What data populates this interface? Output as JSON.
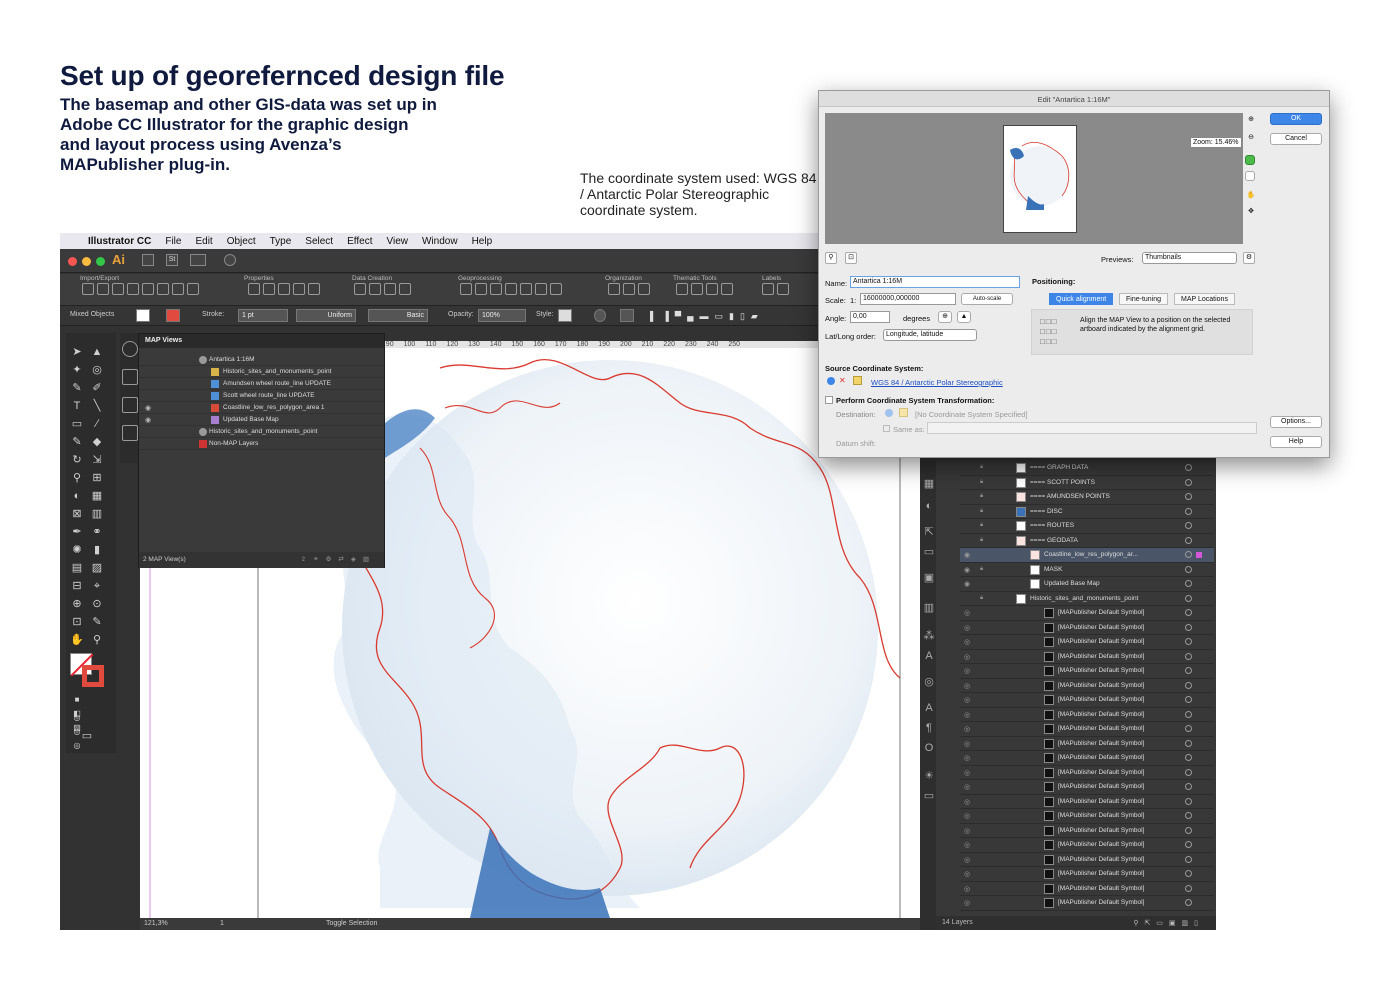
{
  "header": {
    "title": "Set up of georefernced design file",
    "subtitle": "The basemap and other GIS-data was set up in Adobe CC Illustrator for the graphic design and layout process using Avenza’s MAPublisher plug-in.",
    "coord_note": "The coordinate system used: WGS 84 / Antarctic Polar Stereographic coordinate system."
  },
  "menubar": {
    "app_name": "Illustrator CC",
    "items": [
      "File",
      "Edit",
      "Object",
      "Type",
      "Select",
      "Effect",
      "View",
      "Window",
      "Help"
    ]
  },
  "apptop": {
    "logo": "Ai",
    "st": "St"
  },
  "ribbon": {
    "groups": [
      "Import/Export",
      "Properties",
      "Data Creation",
      "Geoprocessing",
      "Organization",
      "Thematic Tools",
      "Labels"
    ]
  },
  "control_bar": {
    "selection": "Mixed Objects",
    "stroke_label": "Stroke:",
    "stroke_value": "1 pt",
    "profile": "Uniform",
    "brush": "Basic",
    "opacity_label": "Opacity:",
    "opacity_value": "100%",
    "style_label": "Style:"
  },
  "ruler": {
    "ticks": [
      "80",
      "90",
      "100",
      "110",
      "120",
      "130",
      "140",
      "150",
      "160",
      "170",
      "180",
      "190",
      "200",
      "210",
      "220",
      "230",
      "240",
      "250"
    ]
  },
  "status_bar": {
    "zoom": "121,3%",
    "page": "1",
    "action": "Toggle Selection"
  },
  "map_views_panel": {
    "title": "MAP Views",
    "rows": [
      {
        "label": "Antartica 1:16M",
        "color": "#9a9a9a"
      },
      {
        "label": "Historic_sites_and_monuments_point",
        "color": "#d8b34a"
      },
      {
        "label": "Amundsen wheel route_line UPDATE",
        "color": "#4f8fd6"
      },
      {
        "label": "Scott wheel route_line UPDATE",
        "color": "#4f8fd6"
      },
      {
        "label": "Coastline_low_res_polygon_area 1",
        "color": "#d84a3a"
      },
      {
        "label": "Updated Base Map",
        "color": "#a77fd0"
      },
      {
        "label": "Historic_sites_and_monuments_point",
        "color": "#9a9a9a"
      },
      {
        "label": "Non-MAP Layers",
        "color": "#cc3333"
      }
    ],
    "footer": "2 MAP View(s)"
  },
  "layers_panel": {
    "rows": [
      {
        "name": "==== GRAPH DATA"
      },
      {
        "name": "==== SCOTT POINTS"
      },
      {
        "name": "==== AMUNDSEN POINTS"
      },
      {
        "name": "==== DISC"
      },
      {
        "name": "==== ROUTES"
      },
      {
        "name": "==== GEODATA"
      },
      {
        "name": "Coastline_low_res_polygon_ar..."
      },
      {
        "name": "MASK"
      },
      {
        "name": "Updated Base Map"
      },
      {
        "name": "Historic_sites_and_monuments_point"
      },
      {
        "name": "[MAPublisher Default Symbol]"
      }
    ],
    "symbol_label": "[MAPublisher Default Symbol]",
    "footer": "14 Layers"
  },
  "dialog": {
    "title": "Edit \"Antartica 1:16M\"",
    "zoom": "Zoom: 15.46%",
    "ok": "OK",
    "cancel": "Cancel",
    "previews_label": "Previews:",
    "previews_value": "Thumbnails",
    "name_label": "Name:",
    "name_value": "Antartica 1:16M",
    "scale_label": "Scale:",
    "scale_prefix": "1:",
    "scale_value": "16000000,000000",
    "autoscale": "Auto-scale",
    "angle_label": "Angle:",
    "angle_value": "0,00",
    "degrees": "degrees",
    "latlong_label": "Lat/Long order:",
    "latlong_value": "Longitude, latitude",
    "positioning_label": "Positioning:",
    "tabs": [
      "Quick alignment",
      "Fine-tuning",
      "MAP Locations"
    ],
    "align_text": "Align the MAP View to a position on the selected artboard indicated by the alignment grid.",
    "source_label": "Source Coordinate System:",
    "source_value": "WGS 84 / Antarctic Polar Stereographic",
    "transform_label": "Perform Coordinate System Transformation:",
    "destination_label": "Destination:",
    "destination_value": "[No Coordinate System Specified]",
    "same_as_label": "Same as:",
    "datum_shift_label": "Datum shift:",
    "options": "Options...",
    "help": "Help"
  },
  "colors": {
    "title": "#0f1a3e",
    "coastline": "#d93a2e",
    "ice": "#eaf1f8",
    "accent": "#3d86e8"
  }
}
